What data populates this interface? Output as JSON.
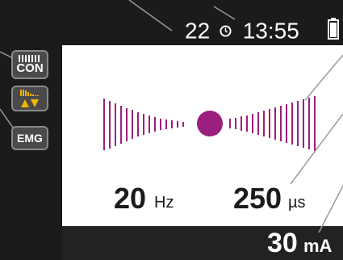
{
  "header": {
    "channel": "22",
    "time": "13:55"
  },
  "sidebar": {
    "con_label": "CON",
    "emg_label": "EMG"
  },
  "stimulation": {
    "frequency_value": "20",
    "frequency_unit": "Hz",
    "pulse_width_value": "250",
    "pulse_width_unit": "µs",
    "intensity_value": "30",
    "intensity_unit": "mA"
  },
  "colors": {
    "accent": "#9b1f7e",
    "warning": "#f5b400"
  }
}
